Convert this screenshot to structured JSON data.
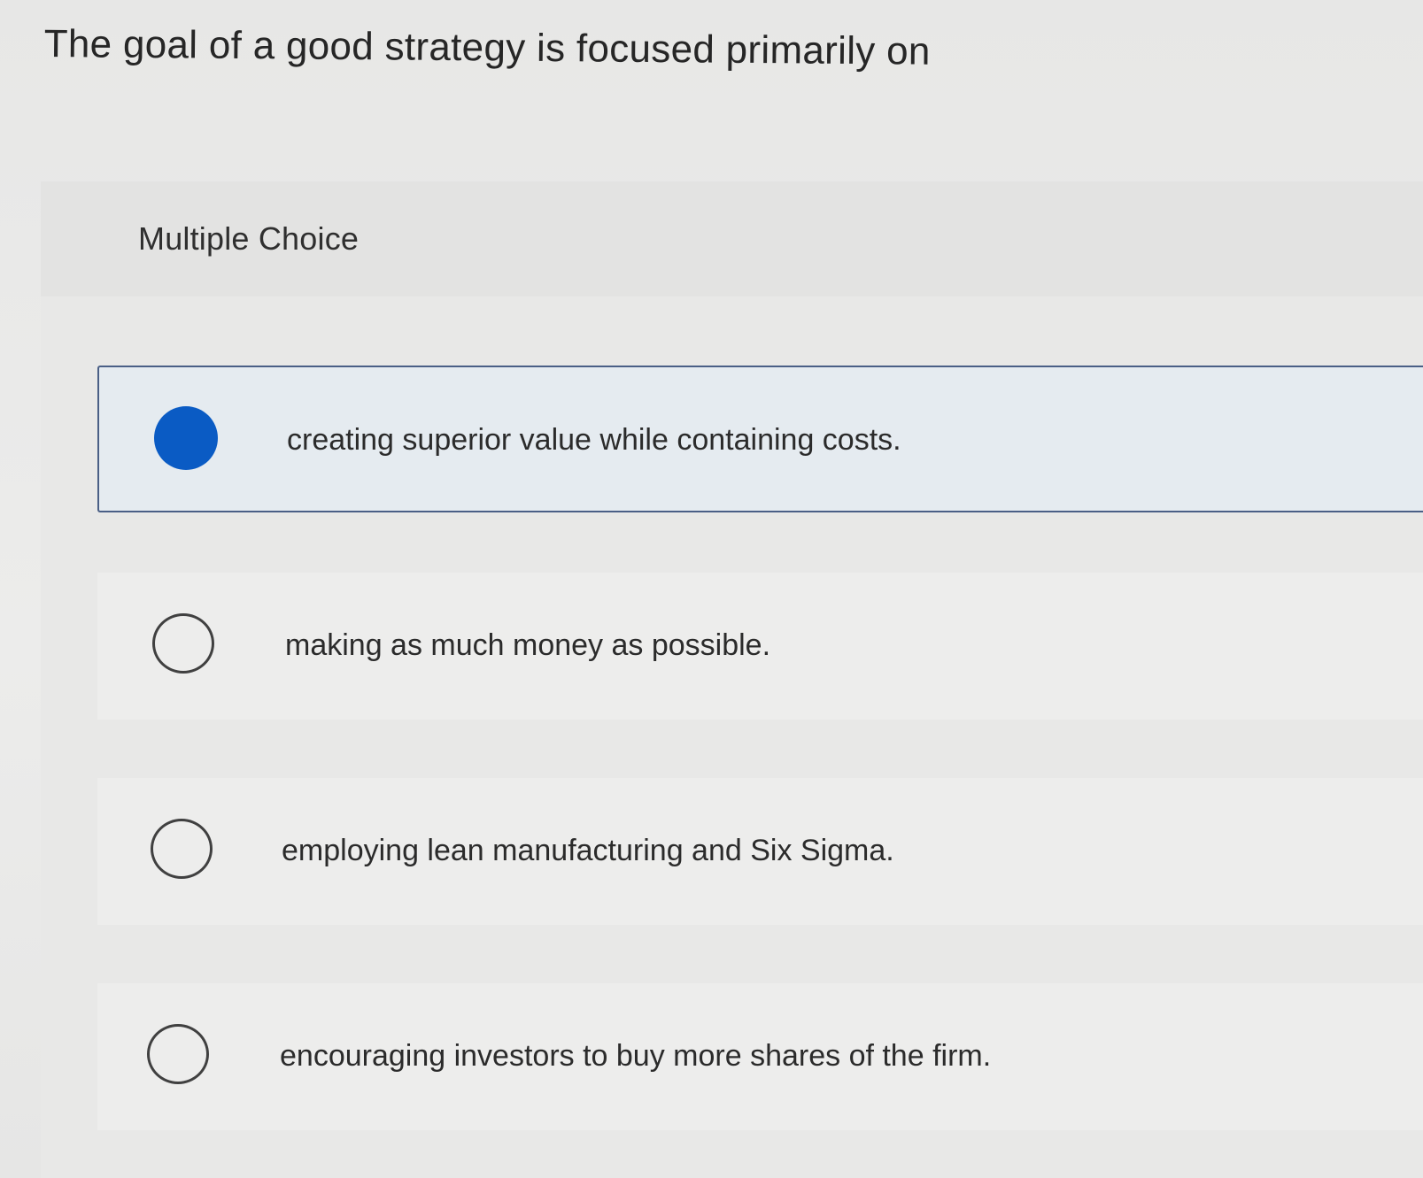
{
  "question": {
    "text": "The goal of a good strategy is focused primarily on"
  },
  "panel": {
    "type_label": "Multiple Choice"
  },
  "options": [
    {
      "label": "creating superior value while containing costs.",
      "selected": true
    },
    {
      "label": "making as much money as possible.",
      "selected": false
    },
    {
      "label": "employing lean manufacturing and Six Sigma.",
      "selected": false
    },
    {
      "label": "encouraging investors to buy more shares of the firm.",
      "selected": false
    }
  ],
  "colors": {
    "accent": "#0a5bc4",
    "selected_border": "#4a5f86",
    "selected_background": "#e5ebf0"
  }
}
